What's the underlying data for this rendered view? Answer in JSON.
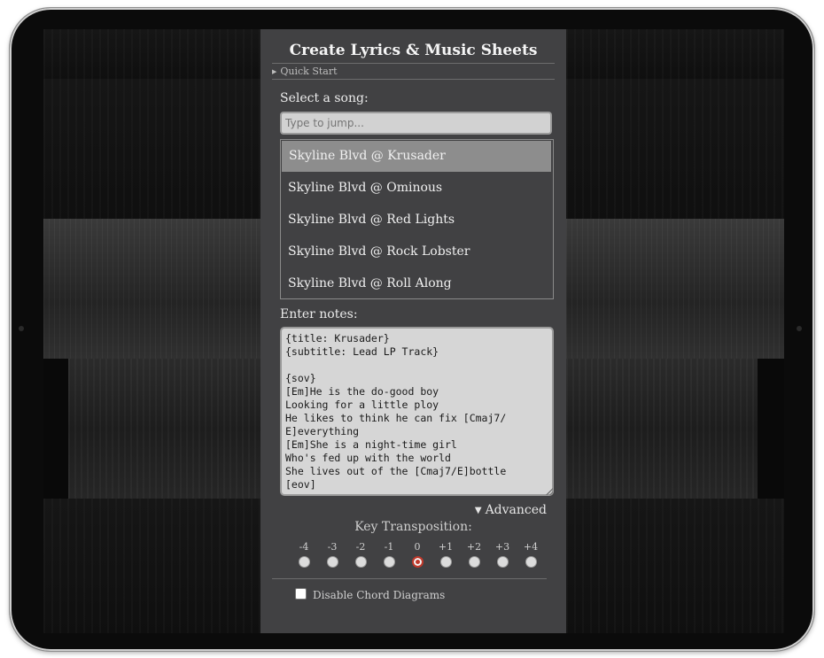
{
  "panel": {
    "title": "Create Lyrics & Music Sheets",
    "quick_start": "Quick Start"
  },
  "song_select": {
    "label": "Select a song:",
    "search_placeholder": "Type to jump...",
    "songs": [
      "Skyline Blvd @ Krusader",
      "Skyline Blvd @ Ominous",
      "Skyline Blvd @ Red Lights",
      "Skyline Blvd @ Rock Lobster",
      "Skyline Blvd @ Roll Along"
    ],
    "selected_index": 0
  },
  "notes": {
    "label": "Enter notes:",
    "value": "{title: Krusader}\n{subtitle: Lead LP Track}\n\n{sov}\n[Em]He is the do-good boy\nLooking for a little ploy\nHe likes to think he can fix [Cmaj7/\nE]everything\n[Em]She is a night-time girl\nWho's fed up with the world\nShe lives out of the [Cmaj7/E]bottle\n[eov]"
  },
  "advanced": {
    "toggle_label": "Advanced",
    "transposition_label": "Key Transposition:",
    "options": [
      "-4",
      "-3",
      "-2",
      "-1",
      "0",
      "+1",
      "+2",
      "+3",
      "+4"
    ],
    "selected": "0",
    "disable_chords_label": "Disable Chord Diagrams",
    "disable_chords_checked": false
  },
  "colors": {
    "accent_radio": "#c0392b",
    "panel_bg": "#464648"
  }
}
